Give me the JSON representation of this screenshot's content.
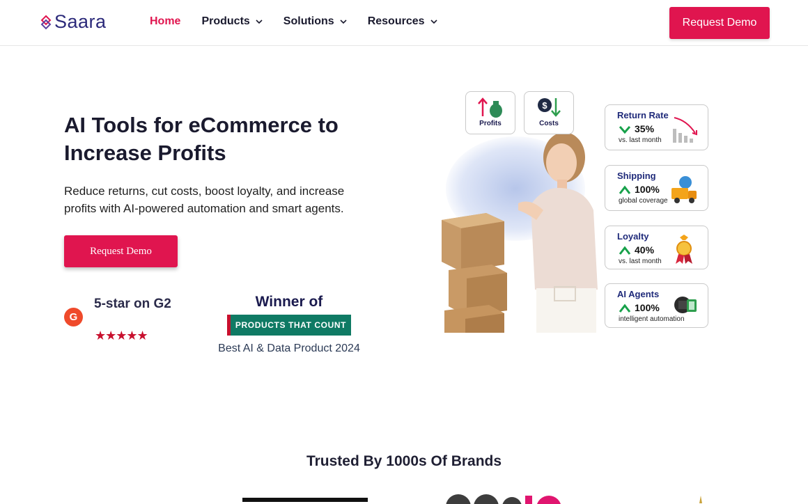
{
  "header": {
    "logo_text": "Saara",
    "nav": [
      {
        "label": "Home",
        "active": true,
        "dropdown": false
      },
      {
        "label": "Products",
        "active": false,
        "dropdown": true
      },
      {
        "label": "Solutions",
        "active": false,
        "dropdown": true
      },
      {
        "label": "Resources",
        "active": false,
        "dropdown": true
      }
    ],
    "cta_label": "Request Demo"
  },
  "hero": {
    "title": "AI Tools for eCommerce to Increase Profits",
    "subtitle": "Reduce returns, cut costs, boost loyalty, and increase profits with AI-powered automation and smart agents.",
    "cta_label": "Request Demo"
  },
  "ratings": {
    "g2_text": "5-star on G2",
    "g2_logo": "G",
    "stars": "★★★★★",
    "winner_text": "Winner of",
    "badge_text": "PRODUCTS THAT COUNT",
    "award_text": "Best AI & Data Product 2024"
  },
  "visual": {
    "mini_cards": [
      {
        "label": "Profits",
        "icon": "money-bag-up-icon"
      },
      {
        "label": "Costs",
        "icon": "coin-down-icon"
      }
    ],
    "metrics": [
      {
        "title": "Return Rate",
        "value": "35%",
        "caption": "vs. last month",
        "trend": "down",
        "icon": "bar-chart-down-icon"
      },
      {
        "title": "Shipping",
        "value": "100%",
        "caption": "global coverage",
        "trend": "up",
        "icon": "delivery-truck-icon"
      },
      {
        "title": "Loyalty",
        "value": "40%",
        "caption": "vs. last month",
        "trend": "up",
        "icon": "award-medal-icon"
      },
      {
        "title": "AI Agents",
        "value": "100%",
        "caption": "intelligent automation",
        "trend": "up",
        "icon": "ai-chip-icon"
      }
    ]
  },
  "trusted": {
    "heading": "Trusted By 1000s Of Brands"
  },
  "colors": {
    "accent": "#e0154f",
    "brand_navy": "#2c2a7a",
    "trend_green": "#17a14a"
  }
}
